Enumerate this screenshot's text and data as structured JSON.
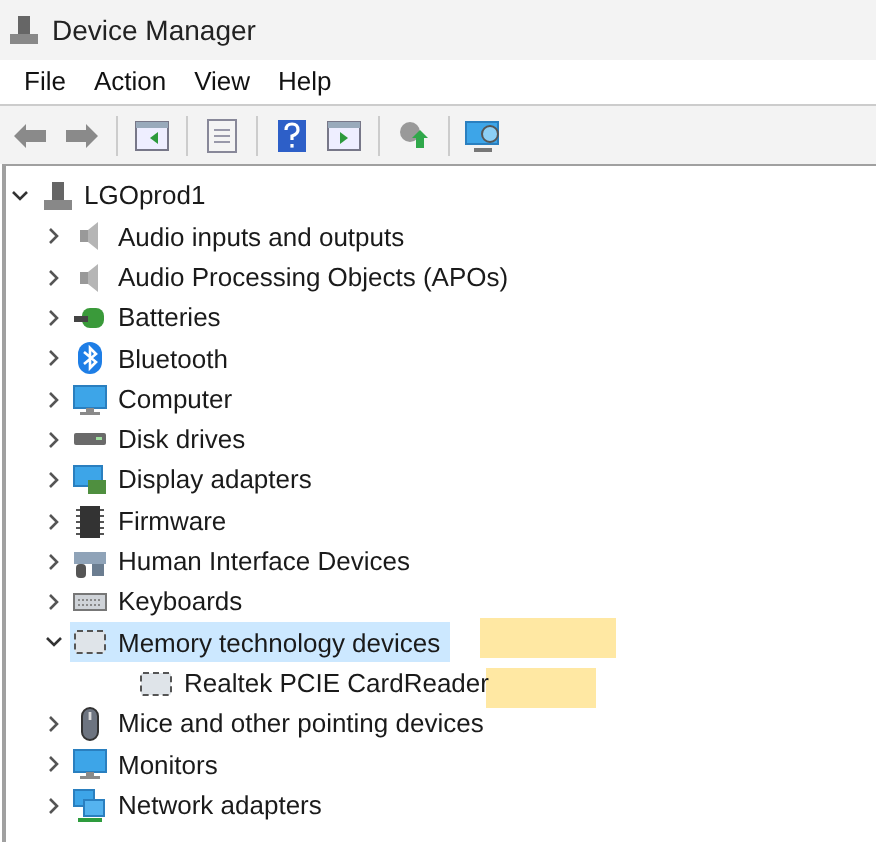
{
  "window": {
    "title": "Device Manager"
  },
  "menu": [
    "File",
    "Action",
    "View",
    "Help"
  ],
  "tree": {
    "label": "LGOprod1",
    "expanded": true,
    "children": [
      {
        "label": "Audio inputs and outputs",
        "expanded": false,
        "selected": false
      },
      {
        "label": "Audio Processing Objects (APOs)",
        "expanded": false,
        "selected": false
      },
      {
        "label": "Batteries",
        "expanded": false,
        "selected": false
      },
      {
        "label": "Bluetooth",
        "expanded": false,
        "selected": false
      },
      {
        "label": "Computer",
        "expanded": false,
        "selected": false
      },
      {
        "label": "Disk drives",
        "expanded": false,
        "selected": false
      },
      {
        "label": "Display adapters",
        "expanded": false,
        "selected": false
      },
      {
        "label": "Firmware",
        "expanded": false,
        "selected": false
      },
      {
        "label": "Human Interface Devices",
        "expanded": false,
        "selected": false
      },
      {
        "label": "Keyboards",
        "expanded": false,
        "selected": false
      },
      {
        "label": "Memory technology devices",
        "expanded": true,
        "selected": true,
        "highlighted": true,
        "children": [
          {
            "label": "Realtek PCIE CardReader",
            "selected": false,
            "highlighted": true
          }
        ]
      },
      {
        "label": "Mice and other pointing devices",
        "expanded": false,
        "selected": false
      },
      {
        "label": "Monitors",
        "expanded": false,
        "selected": false
      },
      {
        "label": "Network adapters",
        "expanded": false,
        "selected": false
      }
    ]
  }
}
